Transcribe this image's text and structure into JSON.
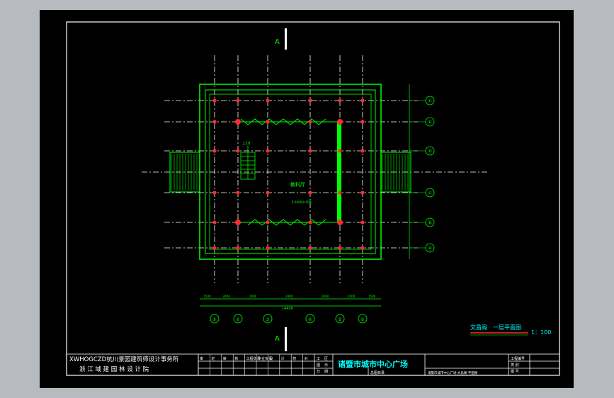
{
  "drawing": {
    "section_marker": "A",
    "room_label": "教科厅",
    "note_text": "4-6480(0.000)",
    "title": "文昌阁　一层平面图",
    "scale": "1：100",
    "axis_numbers": [
      "①",
      "②",
      "③",
      "④",
      "⑤",
      "⑥"
    ],
    "axis_letters": [
      "Ⓕ",
      "Ⓔ",
      "Ⓓ",
      "Ⓒ",
      "Ⓑ",
      "Ⓐ"
    ],
    "dim_labels": [
      "1500",
      "2400",
      "2400",
      "2400",
      "2400",
      "2400",
      "1500"
    ],
    "total_dim": "14400",
    "stair_label": "上18"
  },
  "title_block": {
    "company_line1": "XWHOGCZD杭川景园建筑师设计事务所",
    "company_line2": "浙 江 域 建 园 林 设 计 院",
    "header_cells": [
      "审",
      "定",
      "审",
      "核",
      "工程负责",
      "专业负责",
      "设",
      "计",
      "校",
      "对"
    ],
    "side_cells": [
      "工",
      "区",
      "图",
      "示",
      "日",
      "期"
    ],
    "project_name": "诸暨市城市中心广场",
    "phase": "总图目录",
    "subtitle": "诸暨市城市中心广场·文昌阁·平面图",
    "right_labels": [
      "工程编号",
      "类 别",
      "图 号"
    ]
  },
  "colors": {
    "wall": "#00ff00",
    "axis": "#ffffff",
    "column": "#ff2a2a",
    "text_label": "#00ffff",
    "title_block": "#ffffff"
  }
}
